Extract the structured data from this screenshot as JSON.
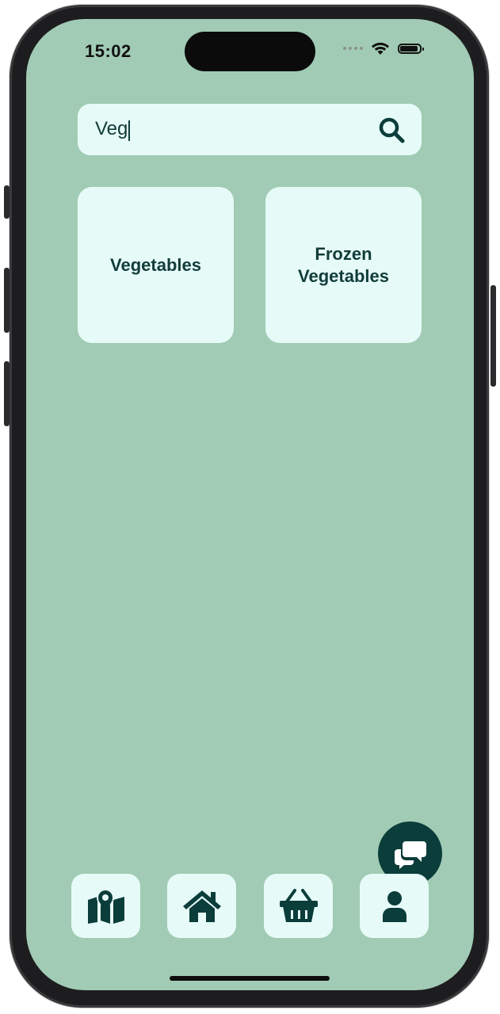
{
  "status_bar": {
    "time": "15:02"
  },
  "search": {
    "value": "Veg",
    "icon": "search-icon"
  },
  "results": [
    {
      "label": "Vegetables"
    },
    {
      "label_line1": "Frozen",
      "label_line2": "Vegetables"
    }
  ],
  "fab": {
    "icon": "chat-bubbles-icon"
  },
  "bottom_nav": {
    "items": [
      {
        "icon": "map-marker-icon"
      },
      {
        "icon": "home-icon"
      },
      {
        "icon": "basket-icon"
      },
      {
        "icon": "user-icon"
      }
    ]
  },
  "colors": {
    "background": "#a1cbb4",
    "card": "#e6fbf8",
    "accent": "#0b3d3a",
    "text": "#123c3a"
  }
}
